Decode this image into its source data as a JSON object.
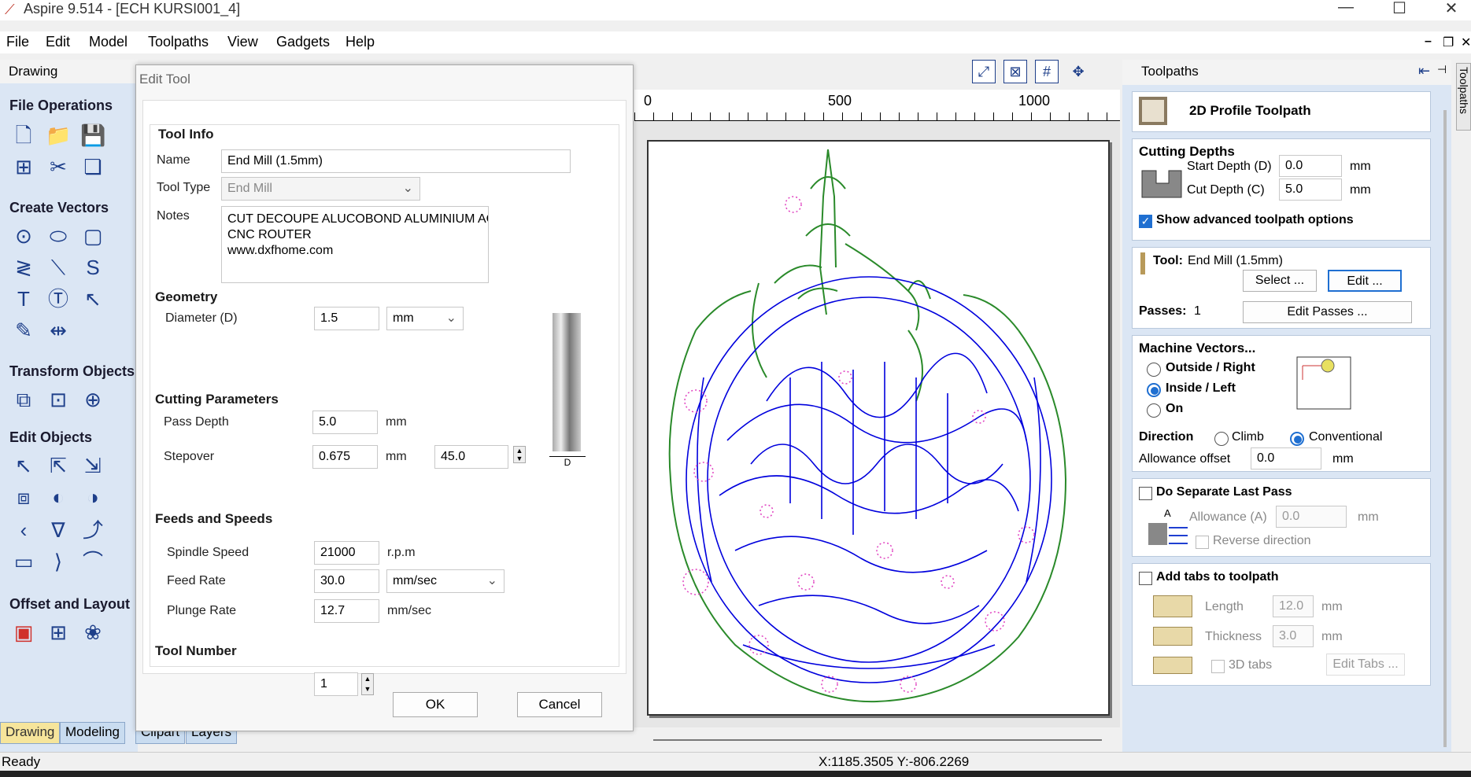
{
  "window": {
    "title": "Aspire 9.514 - [ECH KURSI001_4]"
  },
  "menu": [
    "File",
    "Edit",
    "Model",
    "Toolpaths",
    "View",
    "Gadgets",
    "Help"
  ],
  "left_panel": {
    "header": "Drawing",
    "sections": [
      "File Operations",
      "Create Vectors",
      "Transform Objects",
      "Edit Objects",
      "Offset and Layout"
    ],
    "tabs": [
      "Drawing",
      "Modeling",
      "Clipart",
      "Layers"
    ]
  },
  "ruler": {
    "labels": [
      "0",
      "500",
      "1000"
    ]
  },
  "status": {
    "ready": "Ready",
    "coords": "X:1185.3505 Y:-806.2269"
  },
  "dialog": {
    "title": "Edit Tool",
    "tool_info": {
      "heading": "Tool Info",
      "name_label": "Name",
      "name_value": "End Mill (1.5mm)",
      "type_label": "Tool Type",
      "type_value": "End Mill",
      "notes_label": "Notes",
      "notes_value": "CUT DECOUPE ALUCOBOND ALUMINIUM ACF\nCNC ROUTER\nwww.dxfhome.com"
    },
    "geometry": {
      "heading": "Geometry",
      "diameter_label": "Diameter (D)",
      "diameter_value": "1.5",
      "unit": "mm",
      "dim_label": "D"
    },
    "cutting": {
      "heading": "Cutting Parameters",
      "pass_depth_label": "Pass Depth",
      "pass_depth_value": "5.0",
      "pass_depth_unit": "mm",
      "stepover_label": "Stepover",
      "stepover_value": "0.675",
      "stepover_unit": "mm",
      "stepover_percent": "45.0"
    },
    "feeds": {
      "heading": "Feeds and Speeds",
      "spindle_label": "Spindle Speed",
      "spindle_value": "21000",
      "spindle_unit": "r.p.m",
      "feed_label": "Feed Rate",
      "feed_value": "30.0",
      "feed_unit": "mm/sec",
      "plunge_label": "Plunge Rate",
      "plunge_value": "12.7",
      "plunge_unit": "mm/sec"
    },
    "tool_number": {
      "label": "Tool Number",
      "value": "1"
    },
    "ok_label": "OK",
    "cancel_label": "Cancel"
  },
  "toolpaths_panel": {
    "header": "Toolpaths",
    "side_tab": "Toolpaths",
    "title": "2D Profile Toolpath",
    "cutting_depths": {
      "heading": "Cutting Depths",
      "start_label": "Start Depth (D)",
      "start_value": "0.0",
      "cut_label": "Cut Depth (C)",
      "cut_value": "5.0",
      "unit": "mm",
      "advanced_label": "Show advanced toolpath options"
    },
    "tool": {
      "label": "Tool:",
      "value": "End Mill (1.5mm)",
      "select_label": "Select ...",
      "edit_label": "Edit ...",
      "passes_label": "Passes:",
      "passes_value": "1",
      "edit_passes_label": "Edit Passes ..."
    },
    "machine_vectors": {
      "heading": "Machine Vectors...",
      "outside_label": "Outside / Right",
      "inside_label": "Inside / Left",
      "on_label": "On",
      "direction_label": "Direction",
      "climb_label": "Climb",
      "conventional_label": "Conventional",
      "allowance_label": "Allowance offset",
      "allowance_value": "0.0",
      "unit": "mm"
    },
    "last_pass": {
      "label": "Do Separate Last Pass",
      "allowance_label": "Allowance (A)",
      "allowance_value": "0.0",
      "unit": "mm",
      "reverse_label": "Reverse direction",
      "diagram_label": "A"
    },
    "tabs": {
      "label": "Add tabs to toolpath",
      "length_label": "Length",
      "length_value": "12.0",
      "thickness_label": "Thickness",
      "thickness_value": "3.0",
      "unit": "mm",
      "3d_label": "3D tabs",
      "edit_label": "Edit Tabs ..."
    }
  },
  "colors": {
    "accent": "#1f6fd1",
    "panel": "#dbe6f4",
    "vector_blue": "#0000dd",
    "vector_green": "#2a8a2a",
    "vector_pink": "#e040c0"
  }
}
